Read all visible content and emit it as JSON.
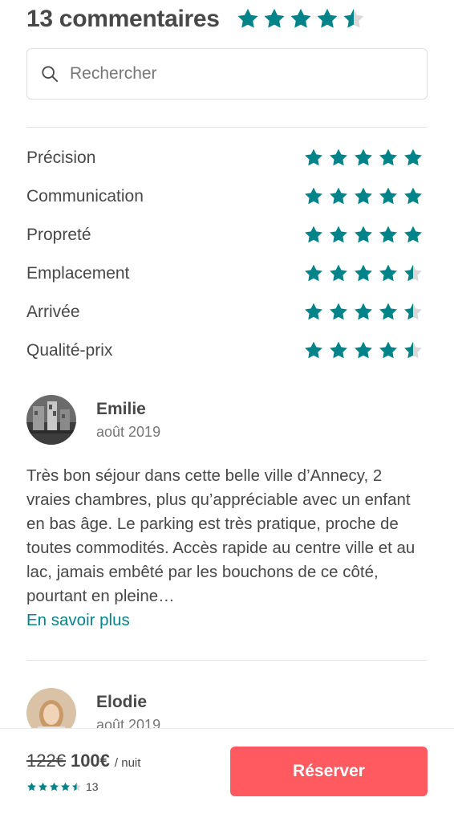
{
  "header": {
    "title": "13 commentaires",
    "overall_rating": 4.5
  },
  "search": {
    "placeholder": "Rechercher",
    "value": ""
  },
  "categories": [
    {
      "label": "Précision",
      "rating": 5
    },
    {
      "label": "Communication",
      "rating": 5
    },
    {
      "label": "Propreté",
      "rating": 5
    },
    {
      "label": "Emplacement",
      "rating": 4.5
    },
    {
      "label": "Arrivée",
      "rating": 4.5
    },
    {
      "label": "Qualité-prix",
      "rating": 4.5
    }
  ],
  "reviews": [
    {
      "name": "Emilie",
      "date": "août 2019",
      "text": "Très bon séjour dans cette belle ville d’Annecy, 2 vraies chambres, plus qu’appréciable avec un enfant en bas âge. Le parking est très pratique, proche de toutes commodités. Accès rapide au centre ville et au lac, jamais embêté par les bouchons de ce côté, pourtant en pleine…",
      "read_more": "En savoir plus"
    },
    {
      "name": "Elodie",
      "date": "août 2019"
    }
  ],
  "footer": {
    "old_price": "122€",
    "price": "100€",
    "per_night": "/ nuit",
    "rating": 4.5,
    "review_count": "13",
    "book_label": "Réserver"
  },
  "colors": {
    "star": "#008489",
    "star_empty": "#d8d8d8",
    "accent": "#ff5a5f",
    "link": "#008489",
    "text": "#484848"
  }
}
